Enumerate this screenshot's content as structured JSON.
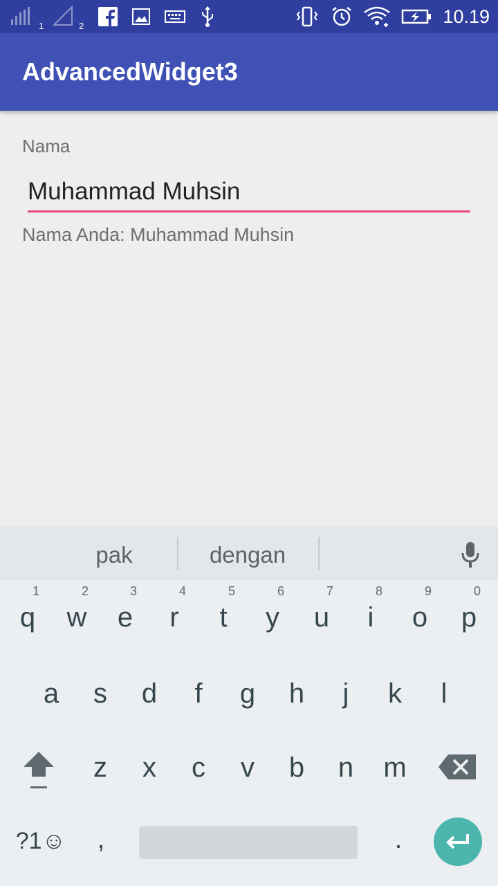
{
  "status_bar": {
    "time": "10.19",
    "sim1_label": "1",
    "sim2_label": "2",
    "background": "#303f9f",
    "icons": [
      "signal-sim1-icon",
      "signal-sim2-icon",
      "facebook-icon",
      "image-icon",
      "keyboard-icon",
      "usb-icon",
      "vibrate-icon",
      "alarm-icon",
      "wifi-icon",
      "battery-charging-icon"
    ]
  },
  "app_bar": {
    "title": "AdvancedWidget3",
    "background": "#3f51b5"
  },
  "form": {
    "label": "Nama",
    "input_value": "Muhammad Muhsin",
    "output_text": "Nama Anda: Muhammad Muhsin",
    "accent": "#e8477d"
  },
  "keyboard": {
    "suggestions": [
      "pak",
      "dengan"
    ],
    "rows": [
      {
        "keys": [
          "q",
          "w",
          "e",
          "r",
          "t",
          "y",
          "u",
          "i",
          "o",
          "p"
        ],
        "hints": [
          "1",
          "2",
          "3",
          "4",
          "5",
          "6",
          "7",
          "8",
          "9",
          "0"
        ]
      },
      {
        "keys": [
          "a",
          "s",
          "d",
          "f",
          "g",
          "h",
          "j",
          "k",
          "l"
        ]
      },
      {
        "keys": [
          "z",
          "x",
          "c",
          "v",
          "b",
          "n",
          "m"
        ]
      }
    ],
    "symbols_label": "?1☺",
    "comma": ",",
    "period": ".",
    "enter_color": "#4db6ac"
  }
}
